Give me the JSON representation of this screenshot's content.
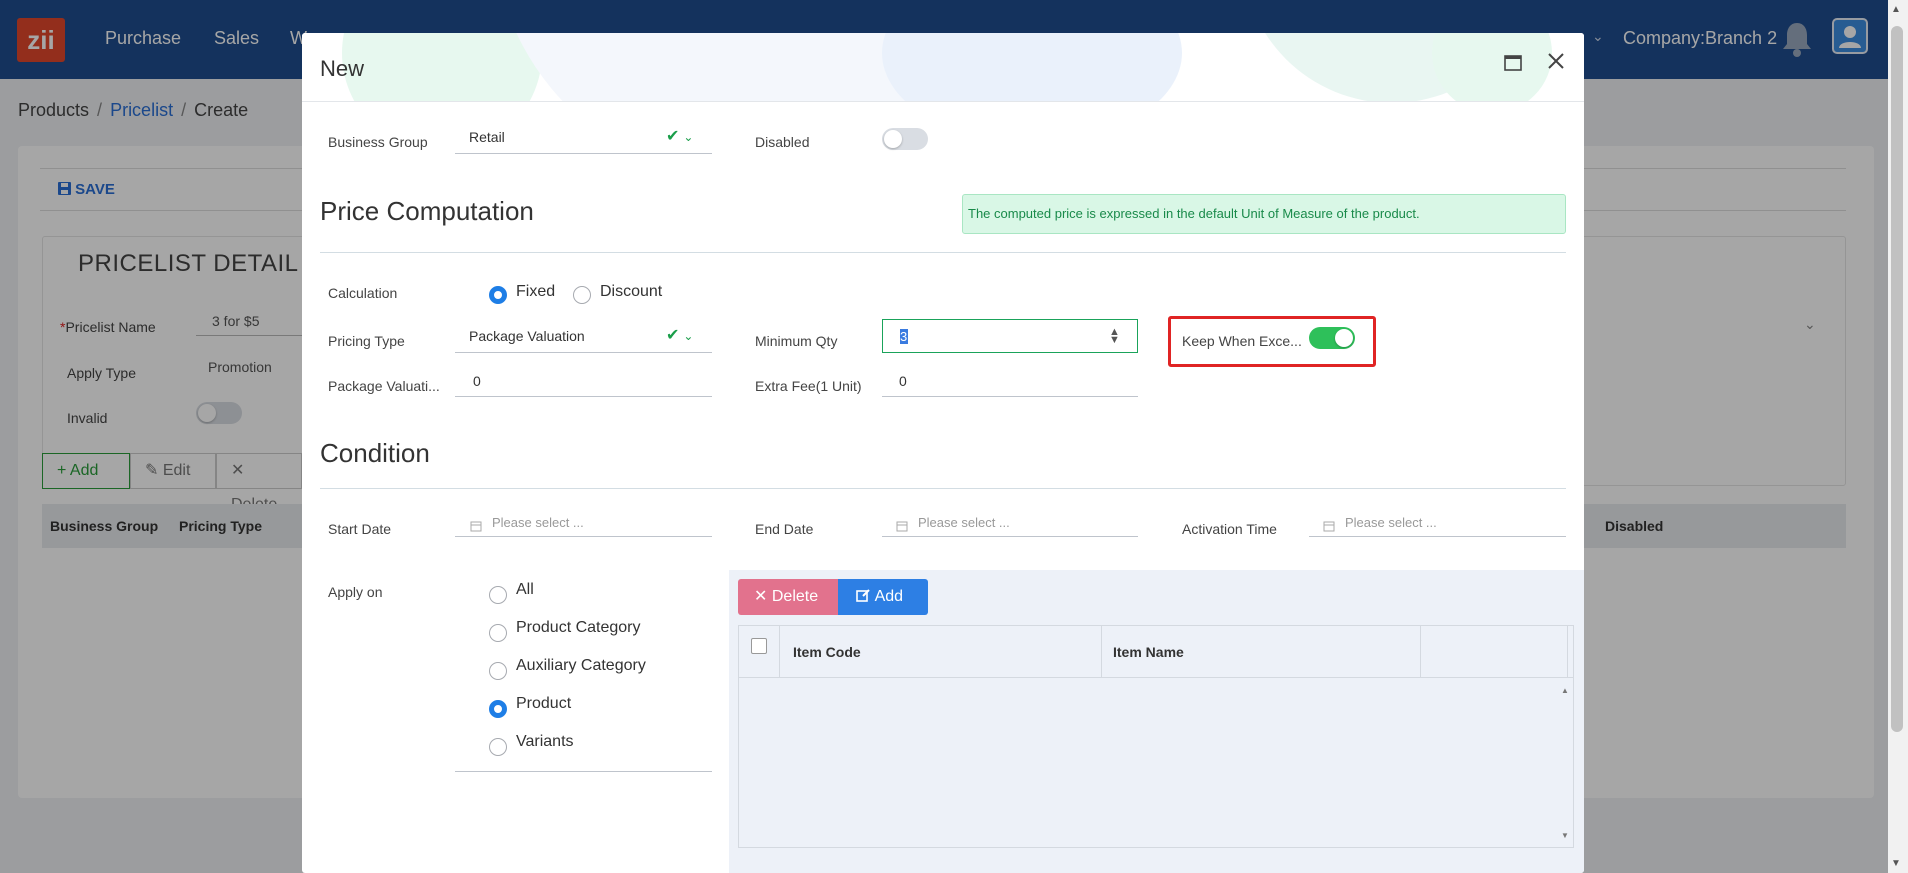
{
  "topnav": {
    "logo": "zii",
    "items": [
      "Purchase",
      "Sales",
      "W"
    ],
    "company": "Company:Branch 2"
  },
  "breadcrumb": {
    "items": [
      "Products",
      "Pricelist",
      "Create"
    ]
  },
  "background": {
    "save_label": "SAVE",
    "panel_title": "PRICELIST DETAIL",
    "pricelist_name_label": "Pricelist Name",
    "pricelist_name_value": "3 for $5",
    "apply_type_label": "Apply Type",
    "apply_type_value": "Promotion",
    "invalid_label": "Invalid",
    "add_label": "Add",
    "edit_label": "Edit",
    "delete_label": "Delete",
    "table_headers": [
      "Business Group",
      "Pricing Type",
      "Disabled"
    ]
  },
  "modal": {
    "title": "New",
    "business_group_label": "Business Group",
    "business_group_value": "Retail",
    "disabled_label": "Disabled",
    "disabled_on": false,
    "price_computation_title": "Price Computation",
    "info_text": "The computed price is expressed in the default Unit of Measure of the product.",
    "calculation_label": "Calculation",
    "calculation_options": [
      "Fixed",
      "Discount"
    ],
    "calculation_selected": "Fixed",
    "pricing_type_label": "Pricing Type",
    "pricing_type_value": "Package Valuation",
    "min_qty_label": "Minimum Qty",
    "min_qty_value": "3",
    "keep_when_label": "Keep When Exce...",
    "keep_when_on": true,
    "package_valuation_label": "Package Valuati...",
    "package_valuation_value": "0",
    "extra_fee_label": "Extra Fee(1 Unit)",
    "extra_fee_value": "0",
    "condition_title": "Condition",
    "start_date_label": "Start Date",
    "end_date_label": "End Date",
    "activation_time_label": "Activation Time",
    "date_placeholder": "Please select ...",
    "apply_on_label": "Apply on",
    "apply_on_options": [
      "All",
      "Product Category",
      "Auxiliary Category",
      "Product",
      "Variants"
    ],
    "apply_on_selected": "Product",
    "delete_label": "Delete",
    "add_label": "Add",
    "grid_headers": [
      "Item Code",
      "Item Name"
    ]
  },
  "colors": {
    "nav": "#1f4e8f",
    "accent": "#1e7ee6",
    "success": "#2ec05a",
    "danger_button": "#e2728d",
    "highlight_box": "#e02424"
  }
}
